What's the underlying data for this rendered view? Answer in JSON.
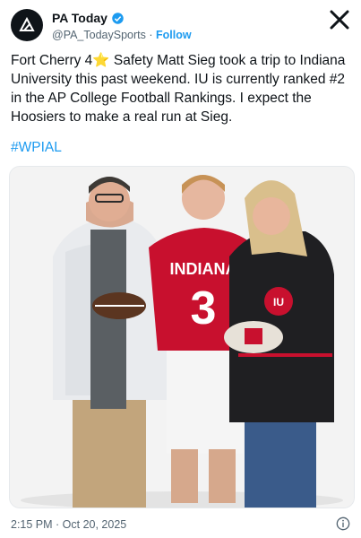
{
  "author": {
    "display_name": "PA Today",
    "handle": "@PA_TodaySports",
    "separator": "·",
    "follow_label": "Follow",
    "avatar_icon": "pa-today-logo-icon"
  },
  "tweet": {
    "text": "Fort Cherry 4⭐ Safety Matt Sieg took a trip to Indiana University this past weekend. IU is currently ranked #2 in the AP College Football Rankings. I expect the Hoosiers to make a real run at Sieg.",
    "hashtag": "#WPIAL"
  },
  "photo": {
    "jersey_name": "INDIANA",
    "jersey_number": "3",
    "helmet_logo": "IU"
  },
  "meta": {
    "timestamp": "2:15 PM · Oct 20, 2025"
  },
  "colors": {
    "link": "#1d9bf0",
    "verified": "#1d9bf0",
    "indiana_crimson": "#c8102e"
  }
}
